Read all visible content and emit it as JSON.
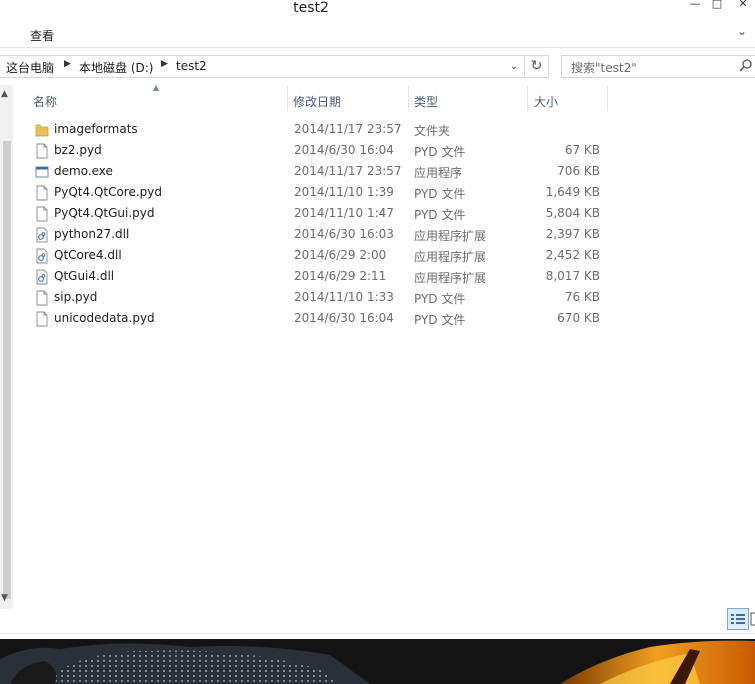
{
  "window": {
    "title": "test2",
    "minimize_icon": "minimize-icon",
    "maximize_icon": "maximize-icon",
    "close_icon": "close-icon"
  },
  "ribbon": {
    "view_tab": "查看",
    "expand_icon": "chevron-down-icon"
  },
  "address_bar": {
    "crumbs": [
      "这台电脑",
      "本地磁盘 (D:)",
      "test2"
    ],
    "dropdown_icon": "chevron-down-icon",
    "refresh_icon": "refresh-icon"
  },
  "search": {
    "placeholder": "搜索\"test2\"",
    "icon": "search-icon"
  },
  "columns": {
    "name": "名称",
    "date": "修改日期",
    "type": "类型",
    "size": "大小"
  },
  "files": [
    {
      "name": "imageformats",
      "date": "2014/11/17 23:57",
      "type": "文件夹",
      "size": "",
      "icon": "folder-icon"
    },
    {
      "name": "bz2.pyd",
      "date": "2014/6/30 16:04",
      "type": "PYD 文件",
      "size": "67 KB",
      "icon": "file-icon"
    },
    {
      "name": "demo.exe",
      "date": "2014/11/17 23:57",
      "type": "应用程序",
      "size": "706 KB",
      "icon": "application-icon"
    },
    {
      "name": "PyQt4.QtCore.pyd",
      "date": "2014/11/10 1:39",
      "type": "PYD 文件",
      "size": "1,649 KB",
      "icon": "file-icon"
    },
    {
      "name": "PyQt4.QtGui.pyd",
      "date": "2014/11/10 1:47",
      "type": "PYD 文件",
      "size": "5,804 KB",
      "icon": "file-icon"
    },
    {
      "name": "python27.dll",
      "date": "2014/6/30 16:03",
      "type": "应用程序扩展",
      "size": "2,397 KB",
      "icon": "dll-icon"
    },
    {
      "name": "QtCore4.dll",
      "date": "2014/6/29 2:00",
      "type": "应用程序扩展",
      "size": "2,452 KB",
      "icon": "dll-icon"
    },
    {
      "name": "QtGui4.dll",
      "date": "2014/6/29 2:11",
      "type": "应用程序扩展",
      "size": "8,017 KB",
      "icon": "dll-icon"
    },
    {
      "name": "sip.pyd",
      "date": "2014/11/10 1:33",
      "type": "PYD 文件",
      "size": "76 KB",
      "icon": "file-icon"
    },
    {
      "name": "unicodedata.pyd",
      "date": "2014/6/30 16:04",
      "type": "PYD 文件",
      "size": "670 KB",
      "icon": "file-icon"
    }
  ],
  "colors": {
    "header_text": "#4c607a",
    "secondary_text": "#6d6d6d",
    "folder": "#e8c158",
    "selection_border": "#79a7d8"
  }
}
